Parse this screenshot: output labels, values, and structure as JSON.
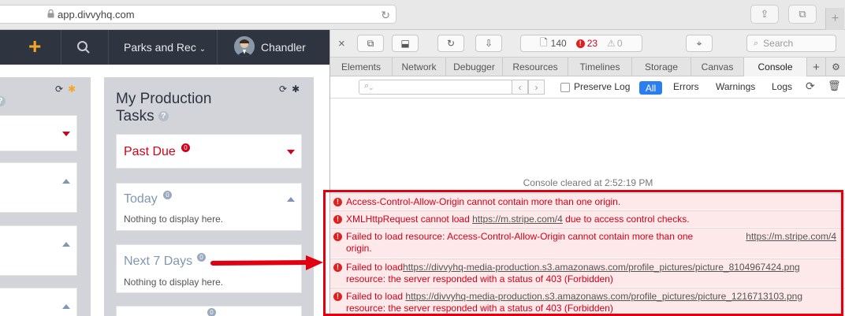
{
  "browser": {
    "url": "app.divvyhq.com"
  },
  "app_nav": {
    "org_name": "Parks and Rec",
    "user_name": "Chandler"
  },
  "production_tasks": {
    "title_line1": "My Production",
    "title_line2": "Tasks",
    "past_due": {
      "label": "Past Due",
      "count": "0"
    },
    "today": {
      "label": "Today",
      "count": "0",
      "empty": "Nothing to display here."
    },
    "next7": {
      "label": "Next 7 Days",
      "count": "0",
      "empty": "Nothing to display here."
    },
    "next_card_count": "0"
  },
  "devtools": {
    "resource_count": "140",
    "error_count": "23",
    "warning_count": "0",
    "search_placeholder": "Search",
    "tabs": [
      "Elements",
      "Network",
      "Debugger",
      "Resources",
      "Timelines",
      "Storage",
      "Canvas",
      "Console"
    ],
    "active_tab": "Console",
    "preserve_log": "Preserve Log",
    "filters": {
      "all": "All",
      "errors": "Errors",
      "warnings": "Warnings",
      "logs": "Logs"
    },
    "console_cleared": "Console cleared at 2:52:19 PM",
    "errors": [
      {
        "text": "Access-Control-Allow-Origin cannot contain more than one origin."
      },
      {
        "prefix": "XMLHttpRequest cannot load ",
        "link": "https://m.stripe.com/4",
        "suffix": " due to access control checks."
      },
      {
        "line1": "Failed to load resource: Access-Control-Allow-Origin cannot contain more than one",
        "line2": "origin.",
        "right_link": "https://m.stripe.com/4"
      },
      {
        "prefix": "Failed to load",
        "link": "https://divvyhq-media-production.s3.amazonaws.com/profile_pictures/picture_8104967424.png",
        "line2": "resource: the server responded with a status of 403 (Forbidden)"
      },
      {
        "prefix": "Failed to load ",
        "link": "https://divvyhq-media-production.s3.amazonaws.com/profile_pictures/picture_1216713103.png",
        "line2": "resource: the server responded with a status of 403 (Forbidden)"
      }
    ]
  },
  "colors": {
    "accent_orange": "#f5a623",
    "error_red": "#d0021b",
    "nav_dark": "#2e3440",
    "filter_active": "#2a7ef2"
  }
}
